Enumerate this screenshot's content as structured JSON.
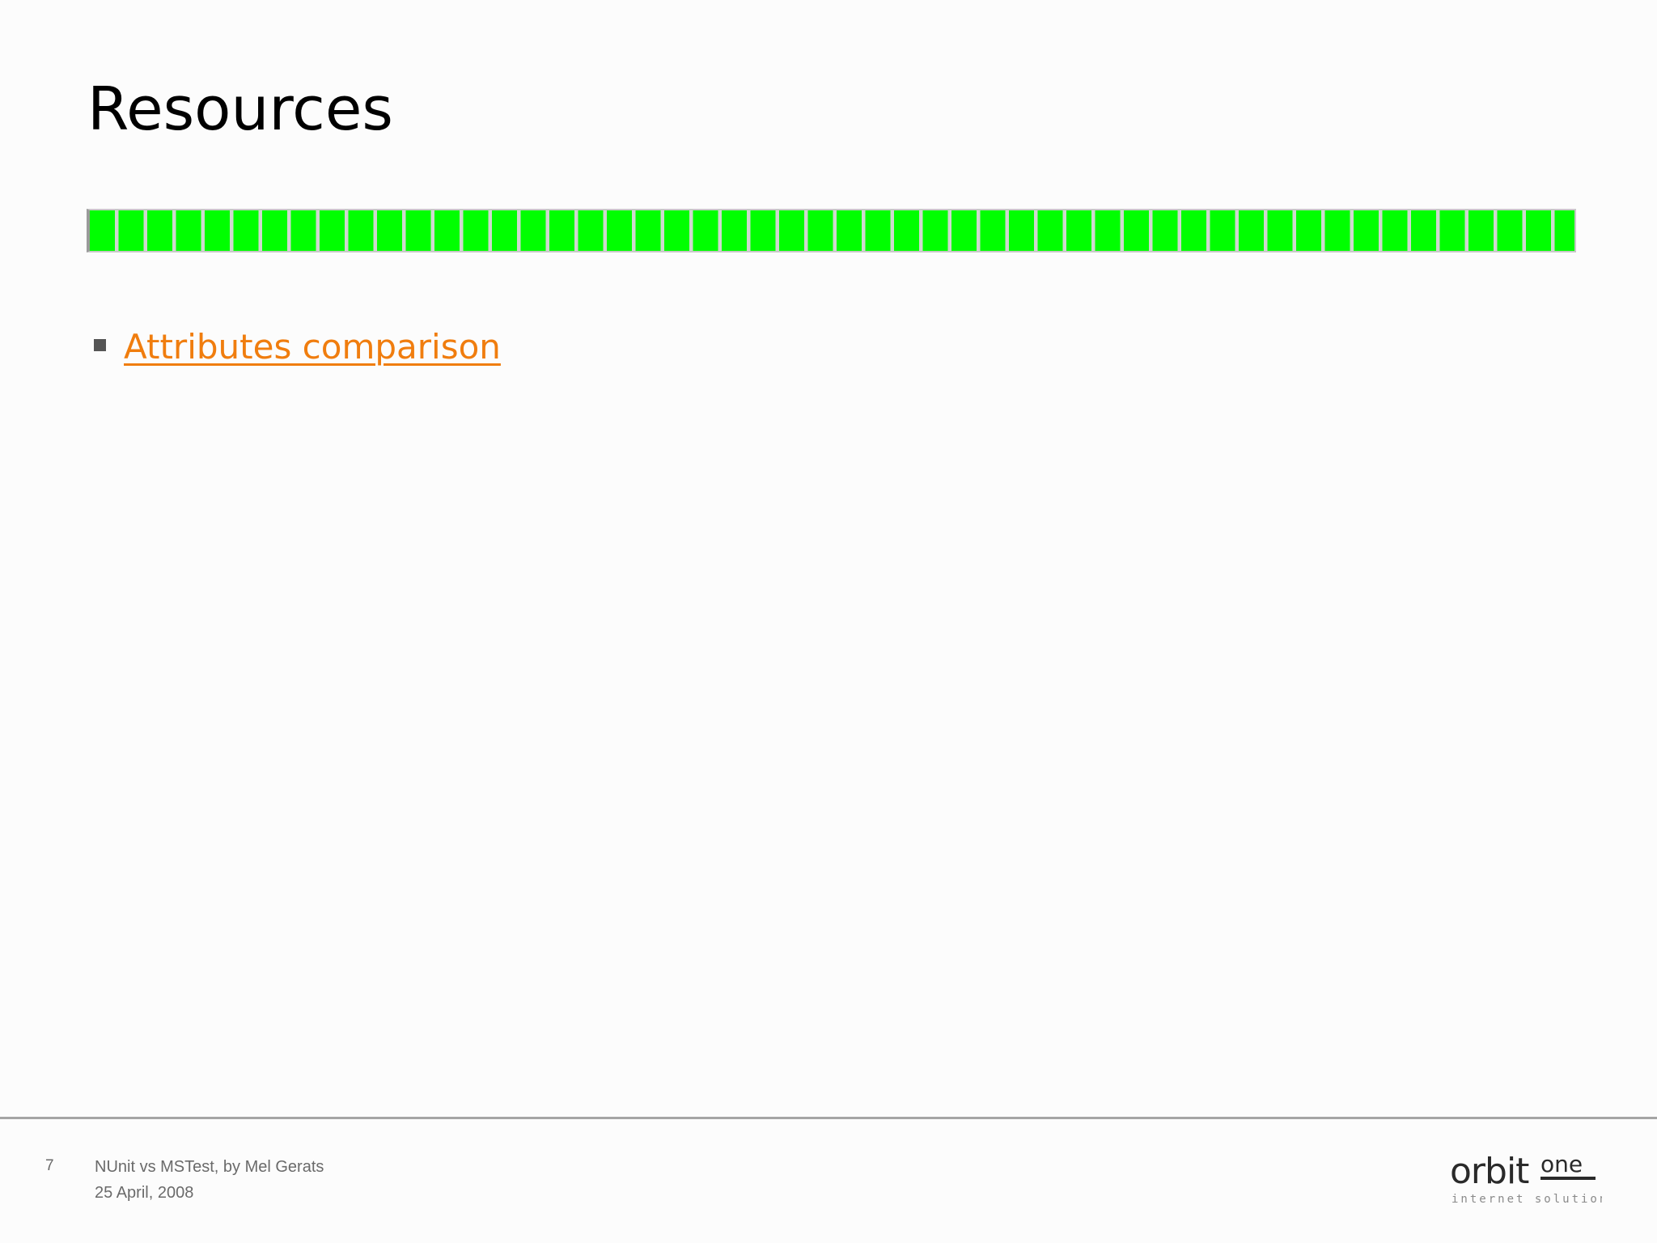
{
  "slide": {
    "title": "Resources"
  },
  "progress": {
    "fraction": 1.0,
    "color": "#00ff00"
  },
  "bullets": [
    {
      "label": "Attributes comparison",
      "color": "#f07d0e"
    }
  ],
  "footer": {
    "page_number": "7",
    "presentation": "NUnit vs MSTest, by Mel Gerats",
    "date": "25 April, 2008"
  },
  "logo": {
    "wordmark_main": "orbit",
    "wordmark_accent": "one",
    "tagline": "internet solutions"
  }
}
